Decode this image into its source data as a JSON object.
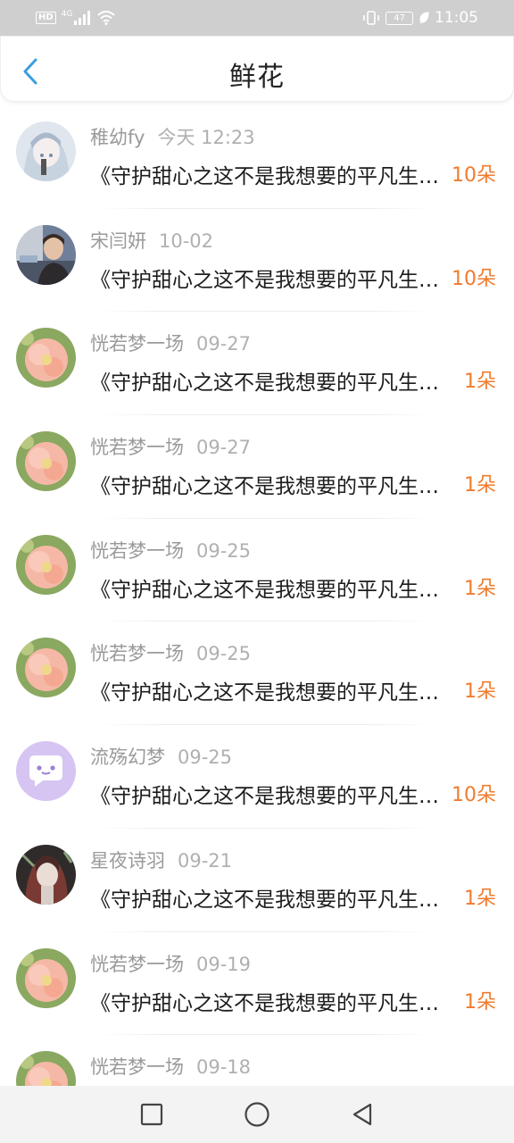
{
  "status_bar": {
    "left_badge": "HD",
    "network": "4G",
    "battery": "47",
    "time": "11:05"
  },
  "header": {
    "title": "鲜花",
    "back_icon": "chevron-left-icon"
  },
  "items": [
    {
      "name": "稚幼fy",
      "date": "今天 12:23",
      "title": "《守护甜心之这不是我想要的平凡生活》",
      "count": "10朵",
      "avatar": "anime-girl"
    },
    {
      "name": "宋闫妍",
      "date": "10-02",
      "title": "《守护甜心之这不是我想要的平凡生活》",
      "count": "10朵",
      "avatar": "photo-person"
    },
    {
      "name": "恍若梦一场",
      "date": "09-27",
      "title": "《守护甜心之这不是我想要的平凡生活》",
      "count": "1朵",
      "avatar": "flower"
    },
    {
      "name": "恍若梦一场",
      "date": "09-27",
      "title": "《守护甜心之这不是我想要的平凡生活》",
      "count": "1朵",
      "avatar": "flower"
    },
    {
      "name": "恍若梦一场",
      "date": "09-25",
      "title": "《守护甜心之这不是我想要的平凡生活》",
      "count": "1朵",
      "avatar": "flower"
    },
    {
      "name": "恍若梦一场",
      "date": "09-25",
      "title": "《守护甜心之这不是我想要的平凡生活》",
      "count": "1朵",
      "avatar": "flower"
    },
    {
      "name": "流殇幻梦",
      "date": "09-25",
      "title": "《守护甜心之这不是我想要的平凡生活》",
      "count": "10朵",
      "avatar": "chat-bubble"
    },
    {
      "name": "星夜诗羽",
      "date": "09-21",
      "title": "《守护甜心之这不是我想要的平凡生活》",
      "count": "1朵",
      "avatar": "dark-anime"
    },
    {
      "name": "恍若梦一场",
      "date": "09-19",
      "title": "《守护甜心之这不是我想要的平凡生活》",
      "count": "1朵",
      "avatar": "flower"
    },
    {
      "name": "恍若梦一场",
      "date": "09-18",
      "title": "",
      "count": "",
      "avatar": "flower"
    }
  ],
  "colors": {
    "accent": "#3a9ee0",
    "count": "#f07b2d",
    "meta": "#9a9a9a"
  },
  "nav": {
    "square": "recent-apps-icon",
    "circle": "home-icon",
    "triangle": "back-icon"
  }
}
